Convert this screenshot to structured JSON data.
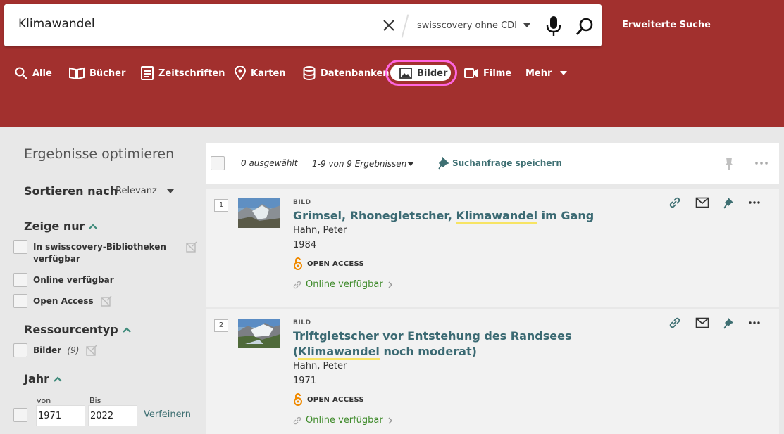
{
  "search": {
    "query": "Klimawandel",
    "scope": "swisscovery ohne CDI",
    "advanced": "Erweiterte Suche"
  },
  "nav": {
    "items": [
      {
        "label": "Alle",
        "icon": "search-icon"
      },
      {
        "label": "Bücher",
        "icon": "book-icon"
      },
      {
        "label": "Zeitschriften",
        "icon": "document-icon"
      },
      {
        "label": "Karten",
        "icon": "map-pin-icon"
      },
      {
        "label": "Datenbanken",
        "icon": "database-icon"
      },
      {
        "label": "Bilder",
        "icon": "image-icon",
        "active": true
      },
      {
        "label": "Filme",
        "icon": "video-icon"
      },
      {
        "label": "Mehr",
        "icon": "chevron-down-icon"
      }
    ],
    "highlight_color": "#ff66e0"
  },
  "sidebar": {
    "title": "Ergebnisse optimieren",
    "sort_label": "Sortieren nach",
    "sort_value": "Relevanz",
    "show_only": {
      "title": "Zeige nur",
      "items": [
        {
          "label": "In swisscovery-Bibliotheken verfügbar"
        },
        {
          "label": "Online verfügbar"
        },
        {
          "label": "Open Access"
        }
      ]
    },
    "resource_type": {
      "title": "Ressourcentyp",
      "items": [
        {
          "label": "Bilder",
          "count": "(9)"
        }
      ]
    },
    "year": {
      "title": "Jahr",
      "from_label": "von",
      "to_label": "Bis",
      "from_value": "1971",
      "to_value": "2022",
      "refine": "Verfeinern"
    }
  },
  "toolbar": {
    "selected": "0 ausgewählt",
    "count": "1-9 von 9 Ergebnissen",
    "save_query": "Suchanfrage speichern"
  },
  "results": [
    {
      "number": "1",
      "type": "BILD",
      "title_before": "Grimsel, Rhonegletscher, ",
      "title_highlight": "Klimawandel",
      "title_after": " im Gang",
      "author": "Hahn, Peter",
      "year": "1984",
      "access": "OPEN ACCESS",
      "online": "Online verfügbar"
    },
    {
      "number": "2",
      "type": "BILD",
      "title_before": "Triftgletscher vor Entstehung des Randsees (",
      "title_highlight": "Klimawandel",
      "title_after": " noch moderat)",
      "author": "Hahn, Peter",
      "year": "1971",
      "access": "OPEN ACCESS",
      "online": "Online verfügbar"
    }
  ],
  "colors": {
    "header": "#a2302e",
    "link": "#3b6a73",
    "online": "#3e8a2a",
    "highlight": "#f7e463",
    "open_access": "#f08a00"
  }
}
